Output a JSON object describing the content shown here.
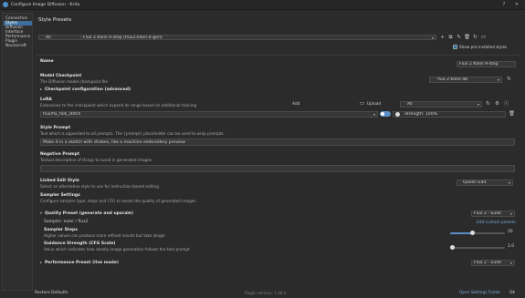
{
  "window": {
    "title": "Configure Image Diffusion - Krita"
  },
  "sidebar": {
    "items": [
      {
        "label": "Connection"
      },
      {
        "label": "Styles"
      },
      {
        "label": "Diffusion"
      },
      {
        "label": "Interface"
      },
      {
        "label": "Performance"
      },
      {
        "label": "Plugin"
      },
      {
        "label": "Neurocraft"
      }
    ]
  },
  "header": {
    "title": "Style Presets",
    "filter_value": "All",
    "preset_value": "Flux 2 Klein 9-step (flux2-klein-4-gen)",
    "show_installed_label": "Show pre-installed styles"
  },
  "name": {
    "label": "Name",
    "value": "Flux 2 Klein 9-step"
  },
  "model": {
    "label": "Model Checkpoint",
    "description": "The Diffusion model checkpoint file",
    "value": "flux-2-klein-4b",
    "config_label": "Checkpoint configuration (advanced)"
  },
  "lora": {
    "label": "LoRA",
    "description": "Extensions to the checkpoint which expand its range based on additional training",
    "add_label": "Add",
    "upload_label": "Upload",
    "filter_value": "All",
    "item_value": "flux/flx_folk_stitch",
    "strength_label": "Strength: 100%",
    "strength": 1.0
  },
  "style_prompt": {
    "label": "Style Prompt",
    "description": "Text which is appended to all prompts. The {prompt} placeholder can be used to wrap prompts.",
    "value": "Make it in a sketch with strokes, like a machine embroidery preview"
  },
  "negative_prompt": {
    "label": "Negative Prompt",
    "description": "Textual description of things to avoid in generated images",
    "value": ""
  },
  "linked_edit": {
    "label": "Linked Edit Style",
    "description": "Select an alternative style to use for instruction-based editing",
    "value": "Queen Edit"
  },
  "sampler_settings": {
    "label": "Sampler Settings",
    "description": "Configure sampler type, steps and CFG to tweak the quality of generated images",
    "quality_label": "Quality Preset (generate and upscale)",
    "quality_value": "Flux 2 - Euler",
    "sampler_text": "Sampler: euler / flux2",
    "edit_presets_label": "Edit custom presets",
    "steps_label": "Sampler Steps",
    "steps_description": "Higher values can produce more refined results but take longer",
    "steps_value": "20",
    "steps_fraction": 0.4,
    "cfg_label": "Guidance Strength (CFG Scale)",
    "cfg_description": "Value which indicates how closely image generation follows the text prompt",
    "cfg_value": "1.0",
    "cfg_fraction": 0.0,
    "performance_label": "Performance Preset (live mode)",
    "performance_value": "Flux 2 - Euler"
  },
  "footer": {
    "restore_label": "Restore Defaults",
    "version_text": "Plugin version: 1.48.0",
    "open_folder_label": "Open Settings Folder",
    "ok_label": "Ok"
  }
}
